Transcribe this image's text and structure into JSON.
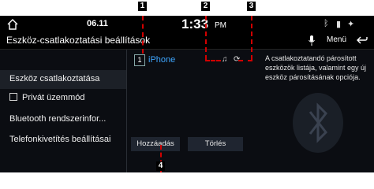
{
  "status_bar": {
    "date": "06.11",
    "time": "1:33",
    "ampm": "PM"
  },
  "header": {
    "title": "Eszköz-csatlakoztatási beállítások",
    "menu_label": "Menü"
  },
  "sidebar": {
    "items": [
      {
        "label": "Eszköz csatlakoztatása",
        "selected": true
      },
      {
        "label": "Privát üzemmód",
        "checkbox": true,
        "checked": false
      },
      {
        "label": "Bluetooth rendszerinfor..."
      },
      {
        "label": "Telefonkivetítés beállításai"
      }
    ]
  },
  "device_list": [
    {
      "index": "1",
      "name": "iPhone"
    }
  ],
  "description": "A csatlakoztatandó párosított eszközök listája, valamint egy új eszköz párosításának opciója.",
  "buttons": {
    "add": "Hozzáadás",
    "delete": "Törlés"
  },
  "callouts": [
    "1",
    "2",
    "3",
    "4"
  ],
  "colors": {
    "accent": "#3ea6ff",
    "callout_line": "#d10000",
    "background": "#0b0d12"
  }
}
